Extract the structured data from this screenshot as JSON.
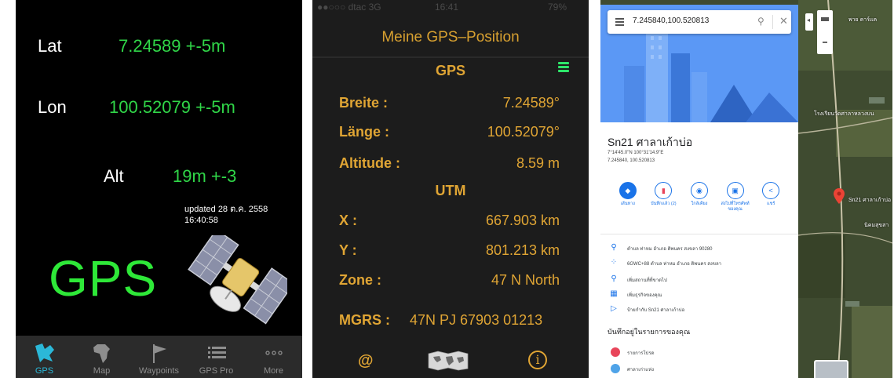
{
  "panel1": {
    "lat_label": "Lat",
    "lat_value": "7.24589 +-5m",
    "lon_label": "Lon",
    "lon_value": "100.52079 +-5m",
    "alt_label": "Alt",
    "alt_value": "19m +-3",
    "updated": "updated 28 ต.ค. 2558 16:40:58",
    "big_title": "GPS",
    "tabs": [
      {
        "label": "GPS",
        "icon": "gps-map-icon",
        "active": true
      },
      {
        "label": "Map",
        "icon": "africa-map-icon",
        "active": false
      },
      {
        "label": "Waypoints",
        "icon": "flag-icon",
        "active": false
      },
      {
        "label": "GPS Pro",
        "icon": "list-icon",
        "active": false
      },
      {
        "label": "More",
        "icon": "more-dots-icon",
        "active": false
      }
    ],
    "colors": {
      "value_green": "#30d648",
      "active_tab": "#2bb8d8"
    }
  },
  "panel2": {
    "status": {
      "carrier": "●●○○○ dtac 3G",
      "time": "16:41",
      "battery": "79%"
    },
    "title": "Meine GPS–Position",
    "section_gps": "GPS",
    "section_utm": "UTM",
    "rows": {
      "breite_label": "Breite :",
      "breite_value": "7.24589°",
      "laenge_label": "Länge :",
      "laenge_value": "100.52079°",
      "altitude_label": "Altitude :",
      "altitude_value": "8.59 m",
      "x_label": "X :",
      "x_value": "667.903 km",
      "y_label": "Y :",
      "y_value": "801.213 km",
      "zone_label": "Zone :",
      "zone_value": "47   N   North"
    },
    "mgrs_label": "MGRS :",
    "mgrs_value": "47N PJ 67903 01213",
    "bottom_at": "@",
    "bottom_info": "i",
    "colors": {
      "text": "#e0a534",
      "menu": "#2ee66a"
    }
  },
  "panel3": {
    "search_text": "7.245840,100.520813",
    "place_name": "Sn21 ศาลาเก้าบ่อ",
    "coords_dms": "7°14'45.0\"N 100°31'14.9\"E",
    "coords_dec": "7.245840, 100.520813",
    "actions": [
      {
        "label": "เส้นทาง",
        "icon": "directions-icon",
        "glyph": "◆"
      },
      {
        "label": "บันทึกแล้ว (2)",
        "icon": "bookmark-icon",
        "glyph": "▮"
      },
      {
        "label": "ใกล้เคียง",
        "icon": "nearby-icon",
        "glyph": "◉"
      },
      {
        "label": "ส่งไปที่โทรศัพท์ของคุณ",
        "icon": "send-to-phone-icon",
        "glyph": "▣"
      },
      {
        "label": "แชร์",
        "icon": "share-icon",
        "glyph": "<"
      }
    ],
    "info_rows": [
      {
        "icon": "pin-icon",
        "glyph": "⚲",
        "text": "ตำบล ท่าหม อำเภอ ติพนคร สงขลา 90280"
      },
      {
        "icon": "plus-code-icon",
        "glyph": "⁘",
        "text": "6GWC+88 ตำบล ท่าหม อำเภอ ติพนคร สงขลา"
      },
      {
        "icon": "add-place-icon",
        "glyph": "⚲",
        "text": "เพิ่มสถานที่ที่ขาดไป"
      },
      {
        "icon": "business-icon",
        "glyph": "▦",
        "text": "เพิ่มธุรกิจของคุณ"
      },
      {
        "icon": "label-icon",
        "glyph": "▷",
        "text": "ป้ายกำกับ  Sn21 ศาลาเก้าบ่อ"
      }
    ],
    "saved_header": "บันทึกอยู่ในรายการของคุณ",
    "saved_rows": [
      {
        "text": "รายการโปรด",
        "color": "#e8455a"
      },
      {
        "text": "ศาลาเก่าแห่ง",
        "color": "#4fa3e8"
      }
    ],
    "map_labels": [
      "พาย คาร์แค",
      "โรงเรียนวัดศาลาหลวงบน",
      "Sn21 ศาลาเก้าบ่อ",
      "นิคมสุขสา"
    ],
    "colors": {
      "accent": "#1a73e8",
      "hero": "#4a8af4",
      "pin": "#ea4335"
    }
  }
}
